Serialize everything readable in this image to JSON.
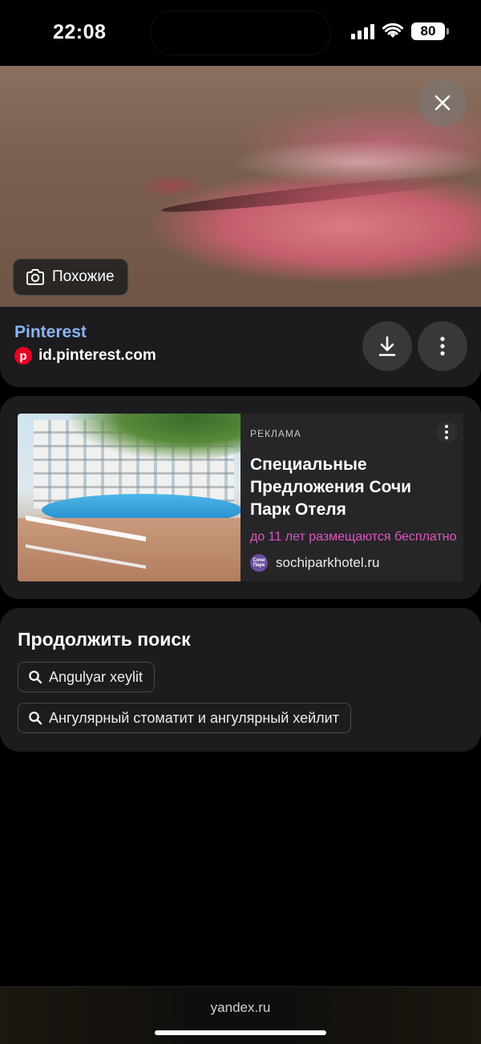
{
  "status_bar": {
    "time": "22:08",
    "battery": "80"
  },
  "hero": {
    "similar_label": "Похожие",
    "close_icon": "close-icon",
    "similar_icon": "camera-search-icon"
  },
  "source": {
    "name": "Pinterest",
    "domain": "id.pinterest.com",
    "logo_letter": "p",
    "download_icon": "download-icon",
    "menu_icon": "more-vertical-icon"
  },
  "ad": {
    "label": "РЕКЛАМА",
    "title": "Специальные Предложения Сочи Парк Отеля",
    "description": "до 11 лет размещаются бесплатно",
    "domain": "sochiparkhotel.ru",
    "logo_text": "Сочи Парк"
  },
  "continue_search": {
    "title": "Продолжить поиск",
    "queries": [
      "Angulyar xeylit",
      "Ангулярный стоматит и ангулярный хейлит"
    ]
  },
  "bottom_bar": {
    "url": "yandex.ru"
  },
  "colors": {
    "source_link": "#8ab4f8",
    "ad_description": "#e056c0",
    "pinterest_red": "#e60023"
  }
}
